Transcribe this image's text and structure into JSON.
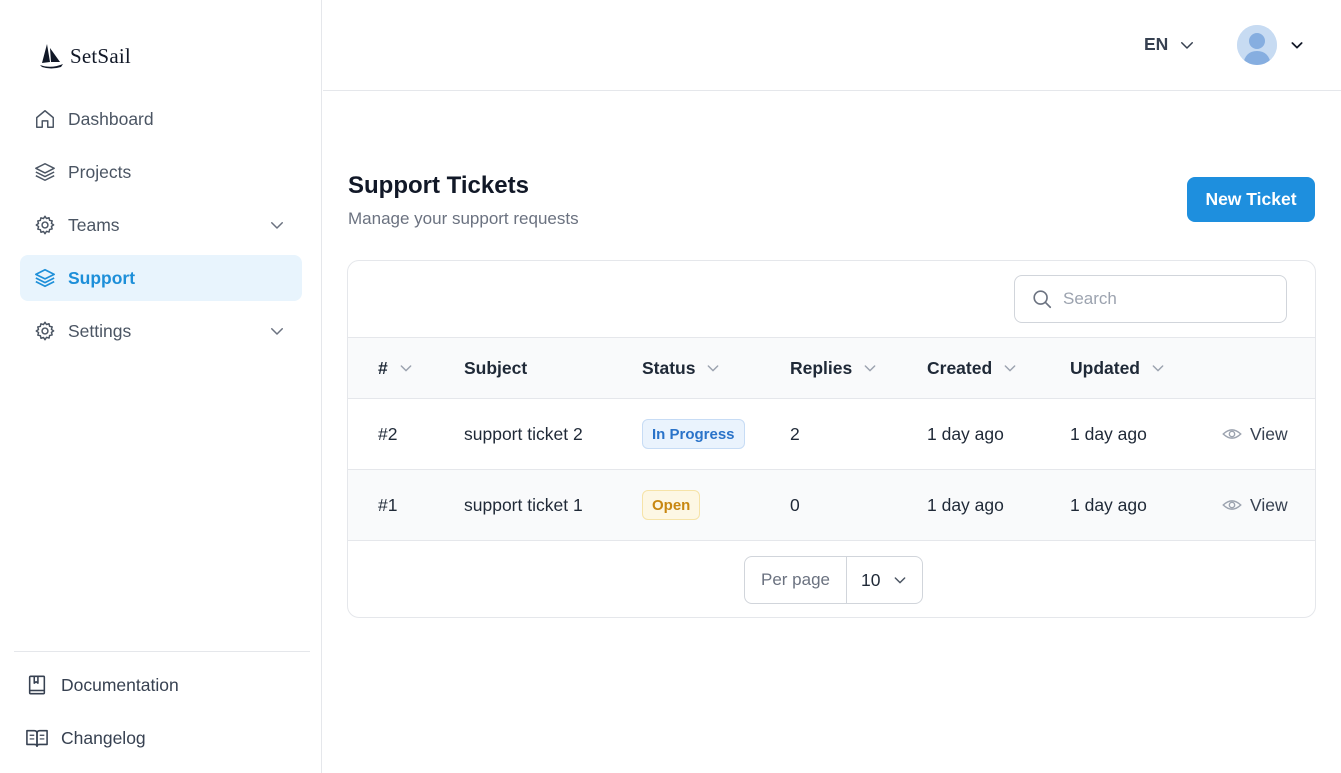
{
  "brand": {
    "name": "SetSail"
  },
  "sidebar": {
    "items": [
      {
        "label": "Dashboard"
      },
      {
        "label": "Projects"
      },
      {
        "label": "Teams"
      },
      {
        "label": "Support"
      },
      {
        "label": "Settings"
      }
    ],
    "bottom": [
      {
        "label": "Documentation"
      },
      {
        "label": "Changelog"
      }
    ]
  },
  "header": {
    "language": "EN"
  },
  "page": {
    "title": "Support Tickets",
    "subtitle": "Manage your support requests",
    "new_button": "New Ticket"
  },
  "search": {
    "placeholder": "Search"
  },
  "table": {
    "columns": [
      "#",
      "Subject",
      "Status",
      "Replies",
      "Created",
      "Updated"
    ],
    "rows": [
      {
        "id": "#2",
        "subject": "support ticket 2",
        "status": "In Progress",
        "replies": "2",
        "created": "1 day ago",
        "updated": "1 day ago",
        "action": "View"
      },
      {
        "id": "#1",
        "subject": "support ticket 1",
        "status": "Open",
        "replies": "0",
        "created": "1 day ago",
        "updated": "1 day ago",
        "action": "View"
      }
    ]
  },
  "pagination": {
    "per_page_label": "Per page",
    "per_page_value": "10"
  },
  "colors": {
    "accent": "#1e8fde",
    "active_bg": "#e8f4fd",
    "in_progress": "#2a73c9",
    "open": "#c88711"
  }
}
